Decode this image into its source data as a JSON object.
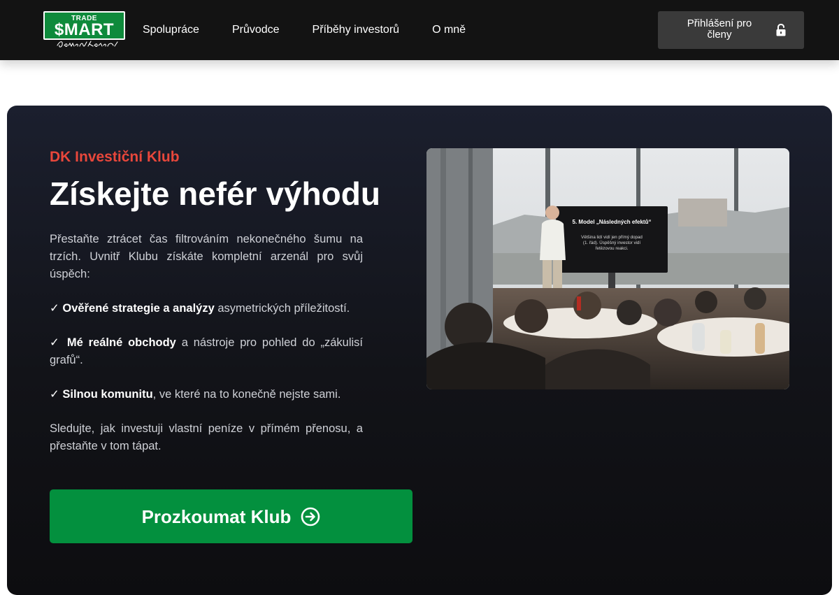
{
  "header": {
    "logo": {
      "top_text": "TRADE",
      "main_text": "$MART",
      "signature": "Dominik Kovařík"
    },
    "nav": [
      {
        "label": "Spolupráce"
      },
      {
        "label": "Průvodce"
      },
      {
        "label": "Příběhy investorů"
      },
      {
        "label": "O mně"
      }
    ],
    "login": {
      "label": "Přihlášení pro členy",
      "icon": "lock-icon"
    }
  },
  "hero": {
    "eyebrow": "DK Investiční Klub",
    "title": "Získejte nefér výhodu",
    "intro": "Přestaňte ztrácet čas filtrováním nekonečného šumu na trzích. Uvnitř Klubu získáte kompletní arzenál pro svůj úspěch:",
    "bullets": [
      {
        "check": "✓",
        "strong": "Ověřené strategie a analýzy",
        "rest": " asymetrických příležitostí."
      },
      {
        "check": "✓ ",
        "strong": "Mé reálné obchody",
        "rest": " a nástroje pro pohled do „zákulisí grafů“."
      },
      {
        "check": "✓",
        "strong": "Silnou komunitu",
        "rest": ", ve které na to konečně nejste sami."
      }
    ],
    "outro": "Sledujte, jak investuji vlastní peníze v přímém přenosu, a přestaňte v tom tápat.",
    "cta": {
      "label": "Prozkoumat Klub",
      "icon": "arrow-circle-right-icon"
    }
  },
  "photo": {
    "screen_title": "5. Model „Následných efektů“",
    "screen_text": [
      "Většina lidí vidí jen přímý dopad",
      "(1. řád). Úspěšný investor vidí",
      "řetězovou reakci."
    ]
  },
  "colors": {
    "header_bg": "#131313",
    "accent_red": "#e8473b",
    "cta_green": "#03903e",
    "logo_green": "#0e8a3b",
    "login_bg": "#3a3a3a"
  }
}
